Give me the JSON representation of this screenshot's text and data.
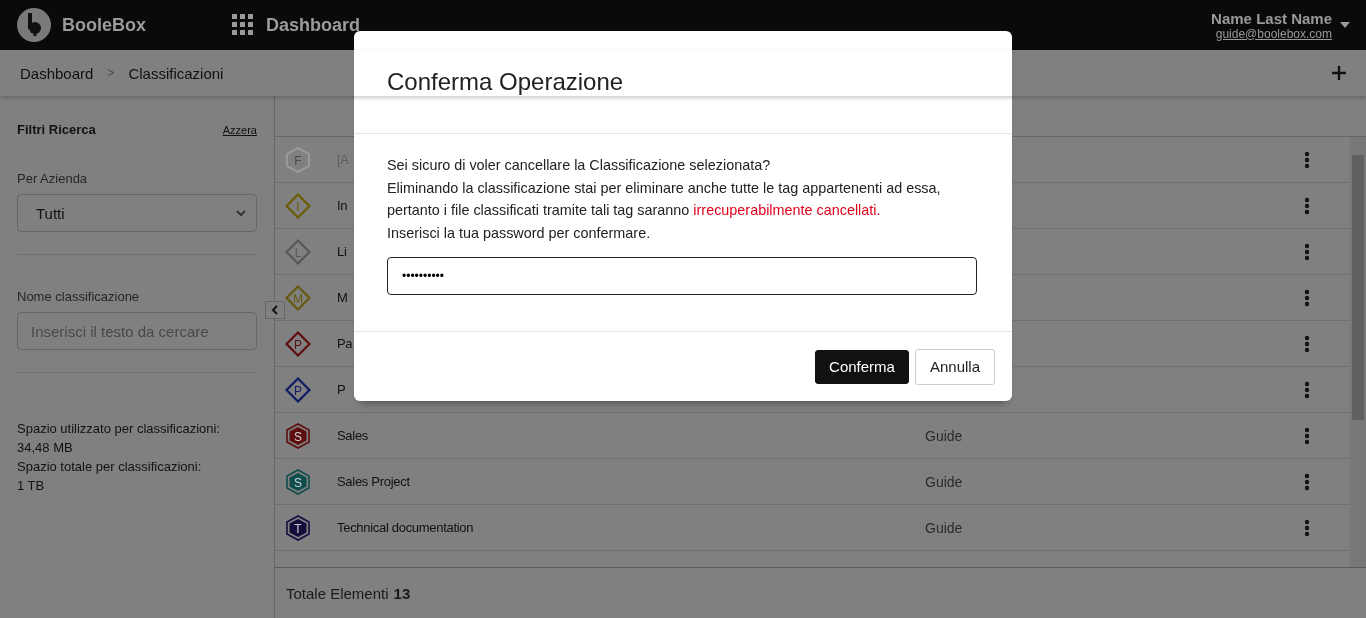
{
  "header": {
    "brand": "BooleBox",
    "title": "Dashboard",
    "user_name": "Name Last Name",
    "user_email": "guide@boolebox.com"
  },
  "breadcrumb": [
    "Dashboard",
    "Classificazioni"
  ],
  "breadcrumb_separator": ">",
  "sidebar": {
    "title": "Filtri Ricerca",
    "reset_link": "Azzera",
    "company_label": "Per Azienda",
    "company_value": "Tutti",
    "name_label": "Nome classificazione",
    "name_placeholder": "Inserisci il testo da cercare",
    "stats": [
      "Spazio utilizzato per classificazioni:",
      "34,48 MB",
      "Spazio totale per classificazioni:",
      "1 TB"
    ]
  },
  "rows": [
    {
      "kind": "hexagon-outline",
      "letter": "F",
      "color": "#9a9a9a",
      "name": "[A",
      "owner": "",
      "disabled": true
    },
    {
      "kind": "diamond",
      "letter": "I",
      "color": "#6a5c00",
      "name": "In",
      "owner": "",
      "disabled": false
    },
    {
      "kind": "diamond",
      "letter": "L",
      "color": "#585858",
      "name": "Li",
      "owner": "",
      "disabled": false
    },
    {
      "kind": "diamond",
      "letter": "M",
      "color": "#645a0f",
      "name": "M",
      "owner": "",
      "disabled": false
    },
    {
      "kind": "diamond",
      "letter": "P",
      "color": "#5c0e0e",
      "name": "Pa",
      "owner": "",
      "disabled": false
    },
    {
      "kind": "diamond",
      "letter": "P",
      "color": "#111a62",
      "name": "P",
      "owner": "",
      "disabled": false
    },
    {
      "kind": "hexagon",
      "letter": "S",
      "color": "#5c0e0e",
      "name": "Sales",
      "owner": "Guide",
      "disabled": false
    },
    {
      "kind": "hexagon",
      "letter": "S",
      "color": "#0f4d4d",
      "name": "Sales Project",
      "owner": "Guide",
      "disabled": false
    },
    {
      "kind": "hexagon",
      "letter": "T",
      "color": "#150d3c",
      "name": "Technical documentation",
      "owner": "Guide",
      "disabled": false
    }
  ],
  "footer": {
    "label": "Totale Elementi",
    "count": "13"
  },
  "dialog": {
    "title": "Conferma Operazione",
    "lines": [
      "Sei sicuro di voler cancellare la Classificazione selezionata?"
    ],
    "warning_text": "Eliminando la classificazione stai per eliminare anche tutte le tag appartenenti ad essa, pertanto i file classificati tramite tali tag saranno ",
    "warning_highlight": "irrecuperabilmente cancellati.",
    "prompt": "Inserisci la tua password per confermare.",
    "password_value": "••••••••••",
    "confirm_button": "Conferma",
    "cancel_button": "Annulla"
  }
}
